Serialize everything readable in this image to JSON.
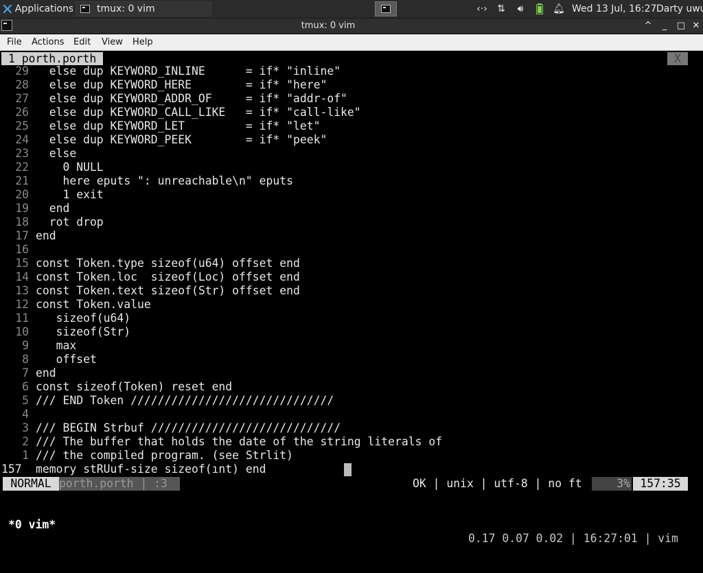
{
  "panel": {
    "apps_label": "Applications",
    "task_label": "tmux: 0 vim",
    "clock": "Wed 13 Jul, 16:27",
    "user": "Darty uwu",
    "tray_icons": [
      "network-arrows-icon",
      "updown-transfer-icon",
      "volume-icon",
      "battery-icon",
      "notification-bell-icon"
    ],
    "tray_glyphs": [
      "‹·›",
      "⇅",
      "🔊︎",
      "▯",
      "🔔︎"
    ]
  },
  "window": {
    "title": "tmux: 0 vim",
    "controls": [
      "^",
      "_",
      "□",
      "✕"
    ]
  },
  "menubar": {
    "items": [
      "File",
      "Actions",
      "Edit",
      "View",
      "Help"
    ]
  },
  "vim": {
    "tab_label": "1 porth.porth",
    "tab_close": "X",
    "lines": [
      {
        "n": "29",
        "code": "  else dup KEYWORD_INLINE      = if* \"inline\""
      },
      {
        "n": "28",
        "code": "  else dup KEYWORD_HERE        = if* \"here\""
      },
      {
        "n": "27",
        "code": "  else dup KEYWORD_ADDR_OF     = if* \"addr-of\""
      },
      {
        "n": "26",
        "code": "  else dup KEYWORD_CALL_LIKE   = if* \"call-like\""
      },
      {
        "n": "25",
        "code": "  else dup KEYWORD_LET         = if* \"let\""
      },
      {
        "n": "24",
        "code": "  else dup KEYWORD_PEEK        = if* \"peek\""
      },
      {
        "n": "23",
        "code": "  else"
      },
      {
        "n": "22",
        "code": "    0 NULL"
      },
      {
        "n": "21",
        "code": "    here eputs \": unreachable\\n\" eputs"
      },
      {
        "n": "20",
        "code": "    1 exit"
      },
      {
        "n": "19",
        "code": "  end"
      },
      {
        "n": "18",
        "code": "  rot drop"
      },
      {
        "n": "17",
        "code": "end"
      },
      {
        "n": "16",
        "code": ""
      },
      {
        "n": "15",
        "code": "const Token.type sizeof(u64) offset end"
      },
      {
        "n": "14",
        "code": "const Token.loc  sizeof(Loc) offset end"
      },
      {
        "n": "13",
        "code": "const Token.text sizeof(Str) offset end"
      },
      {
        "n": "12",
        "code": "const Token.value"
      },
      {
        "n": "11",
        "code": "   sizeof(u64)"
      },
      {
        "n": "10",
        "code": "   sizeof(Str)"
      },
      {
        "n": "9",
        "code": "   max"
      },
      {
        "n": "8",
        "code": "   offset"
      },
      {
        "n": "7",
        "code": "end"
      },
      {
        "n": "6",
        "code": "const sizeof(Token) reset end"
      },
      {
        "n": "5",
        "code": "/// END Token //////////////////////////////"
      },
      {
        "n": "4",
        "code": ""
      },
      {
        "n": "3",
        "code": "/// BEGIN Strbuf ////////////////////////////"
      },
      {
        "n": "2",
        "code": "/// The buffer that holds the date of the string literals of"
      },
      {
        "n": "1",
        "code": "/// the compiled program. (see Strlit)"
      },
      {
        "n": "157",
        "code": "memory stRUuf-size sizeof(ınt) end"
      }
    ],
    "status": {
      "mode": "NORMAL",
      "filename": "porth.porth",
      "sep": "| :3",
      "info": "OK | unix | utf-8 | no ft",
      "percent": "3%",
      "position": "157:35"
    }
  },
  "tmux": {
    "window": "*0 vim*",
    "right": "0.17 0.07 0.02 | 16:27:01 | vim"
  }
}
